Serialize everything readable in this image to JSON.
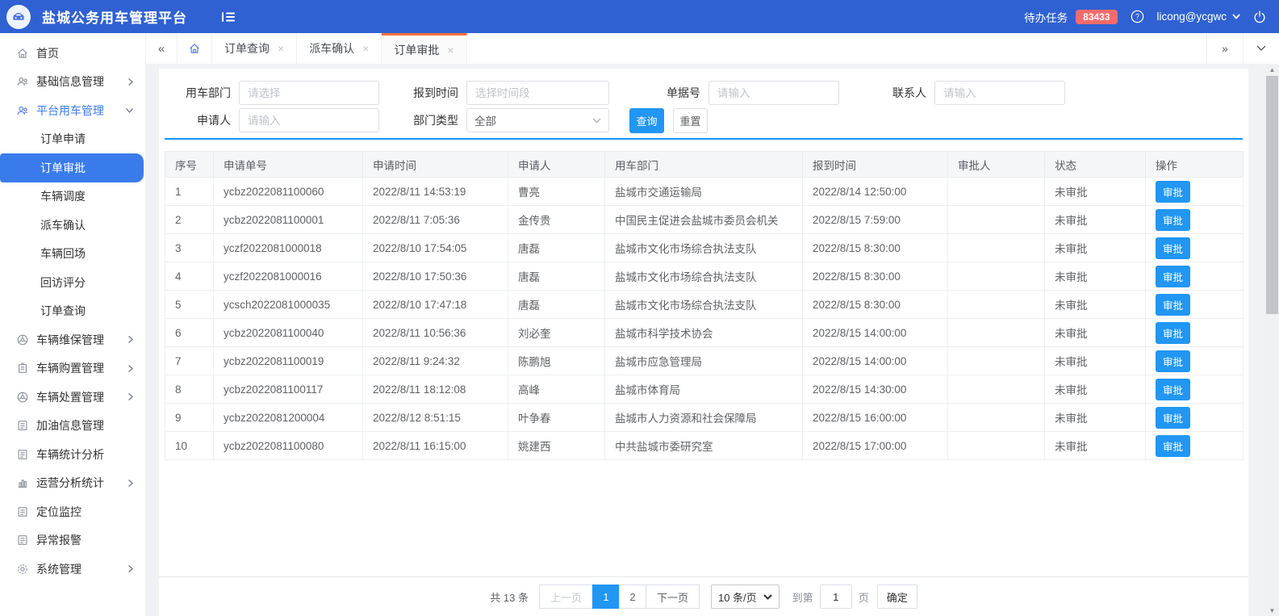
{
  "colors": {
    "header_bg": "#3061d2",
    "primary_button": "#2196f3",
    "sidebar_active_bg": "#3a7bec",
    "badge_red": "#f56c6c",
    "tab_active_top": "#f7703c",
    "filter_divider": "#1890ff"
  },
  "icons": {
    "chevrons_left": "«",
    "chevrons_right": "»",
    "chevron_down_tab": "⌄",
    "close": "×",
    "logo": "car-logo",
    "fold": "menu-fold",
    "help": "question-circle",
    "logout": "power",
    "scroll_up": "▲",
    "scroll_down": "▼"
  },
  "header": {
    "title": "盐城公务用车管理平台",
    "tasks_label": "待办任务",
    "tasks_count": "83433",
    "user": "licong@ycgwc"
  },
  "tabbar": {
    "tabs": [
      {
        "key": "order-query",
        "label": "订单查询",
        "active": false
      },
      {
        "key": "dispatch-confirm",
        "label": "派车确认",
        "active": false
      },
      {
        "key": "order-approval",
        "label": "订单审批",
        "active": true
      }
    ]
  },
  "sidebar": {
    "items": [
      {
        "key": "home",
        "label": "首页",
        "icon": "home",
        "type": "item"
      },
      {
        "key": "base-info",
        "label": "基础信息管理",
        "icon": "users",
        "type": "parent",
        "chevron": "right"
      },
      {
        "key": "platform-vehicle",
        "label": "平台用车管理",
        "icon": "platform",
        "type": "parent",
        "chevron": "down",
        "open": true
      },
      {
        "key": "order-apply",
        "label": "订单申请",
        "type": "sub"
      },
      {
        "key": "order-approval",
        "label": "订单审批",
        "type": "sub",
        "active": true
      },
      {
        "key": "vehicle-dispatch",
        "label": "车辆调度",
        "type": "sub"
      },
      {
        "key": "dispatch-confirm",
        "label": "派车确认",
        "type": "sub"
      },
      {
        "key": "vehicle-return",
        "label": "车辆回场",
        "type": "sub"
      },
      {
        "key": "visit-score",
        "label": "回访评分",
        "type": "sub"
      },
      {
        "key": "order-query",
        "label": "订单查询",
        "type": "sub"
      },
      {
        "key": "maintenance",
        "label": "车辆维保管理",
        "icon": "wheel",
        "type": "parent",
        "chevron": "right"
      },
      {
        "key": "purchase",
        "label": "车辆购置管理",
        "icon": "purchase",
        "type": "parent",
        "chevron": "right"
      },
      {
        "key": "disposal",
        "label": "车辆处置管理",
        "icon": "wheel",
        "type": "parent",
        "chevron": "right"
      },
      {
        "key": "fuel-info",
        "label": "加油信息管理",
        "icon": "doc",
        "type": "item"
      },
      {
        "key": "vehicle-stats",
        "label": "车辆统计分析",
        "icon": "doc",
        "type": "item"
      },
      {
        "key": "operation-analysis",
        "label": "运营分析统计",
        "icon": "chart",
        "type": "parent",
        "chevron": "right"
      },
      {
        "key": "location-monitor",
        "label": "定位监控",
        "icon": "doc",
        "type": "item"
      },
      {
        "key": "abnormal-alarm",
        "label": "异常报警",
        "icon": "doc",
        "type": "item"
      },
      {
        "key": "system",
        "label": "系统管理",
        "icon": "gear",
        "type": "parent",
        "chevron": "right"
      }
    ]
  },
  "filters": {
    "dept_label": "用车部门",
    "dept_placeholder": "请选择",
    "report_time_label": "报到时间",
    "report_time_placeholder": "选择时间段",
    "doc_no_label": "单据号",
    "doc_no_placeholder": "请输入",
    "contact_label": "联系人",
    "contact_placeholder": "请输入",
    "applicant_label": "申请人",
    "applicant_placeholder": "请输入",
    "dept_type_label": "部门类型",
    "dept_type_value": "全部",
    "search_label": "查询",
    "reset_label": "重置"
  },
  "table": {
    "columns": [
      "序号",
      "申请单号",
      "申请时间",
      "申请人",
      "用车部门",
      "报到时间",
      "审批人",
      "状态",
      "操作"
    ],
    "action_label": "审批",
    "rows": [
      [
        "1",
        "ycbz2022081100060",
        "2022/8/11 14:53:19",
        "曹亮",
        "盐城市交通运输局",
        "2022/8/14 12:50:00",
        "",
        "未审批"
      ],
      [
        "2",
        "ycbz2022081100001",
        "2022/8/11 7:05:36",
        "金传贵",
        "中国民主促进会盐城市委员会机关",
        "2022/8/15 7:59:00",
        "",
        "未审批"
      ],
      [
        "3",
        "yczf2022081000018",
        "2022/8/10 17:54:05",
        "唐磊",
        "盐城市文化市场综合执法支队",
        "2022/8/15 8:30:00",
        "",
        "未审批"
      ],
      [
        "4",
        "yczf2022081000016",
        "2022/8/10 17:50:36",
        "唐磊",
        "盐城市文化市场综合执法支队",
        "2022/8/15 8:30:00",
        "",
        "未审批"
      ],
      [
        "5",
        "ycsch2022081000035",
        "2022/8/10 17:47:18",
        "唐磊",
        "盐城市文化市场综合执法支队",
        "2022/8/15 8:30:00",
        "",
        "未审批"
      ],
      [
        "6",
        "ycbz2022081100040",
        "2022/8/11 10:56:36",
        "刘必奎",
        "盐城市科学技术协会",
        "2022/8/15 14:00:00",
        "",
        "未审批"
      ],
      [
        "7",
        "ycbz2022081100019",
        "2022/8/11 9:24:32",
        "陈鹏旭",
        "盐城市应急管理局",
        "2022/8/15 14:00:00",
        "",
        "未审批"
      ],
      [
        "8",
        "ycbz2022081100117",
        "2022/8/11 18:12:08",
        "高峰",
        "盐城市体育局",
        "2022/8/15 14:30:00",
        "",
        "未审批"
      ],
      [
        "9",
        "ycbz2022081200004",
        "2022/8/12 8:51:15",
        "叶争春",
        "盐城市人力资源和社会保障局",
        "2022/8/15 16:00:00",
        "",
        "未审批"
      ],
      [
        "10",
        "ycbz2022081100080",
        "2022/8/11 16:15:00",
        "姚建西",
        "中共盐城市委研究室",
        "2022/8/15 17:00:00",
        "",
        "未审批"
      ]
    ]
  },
  "pagination": {
    "total": "共 13 条",
    "prev": "上一页",
    "pages": [
      "1",
      "2"
    ],
    "active_page": "1",
    "next": "下一页",
    "page_size": "10 条/页",
    "goto_prefix": "到第",
    "goto_value": "1",
    "goto_suffix": "页",
    "confirm": "确定"
  }
}
